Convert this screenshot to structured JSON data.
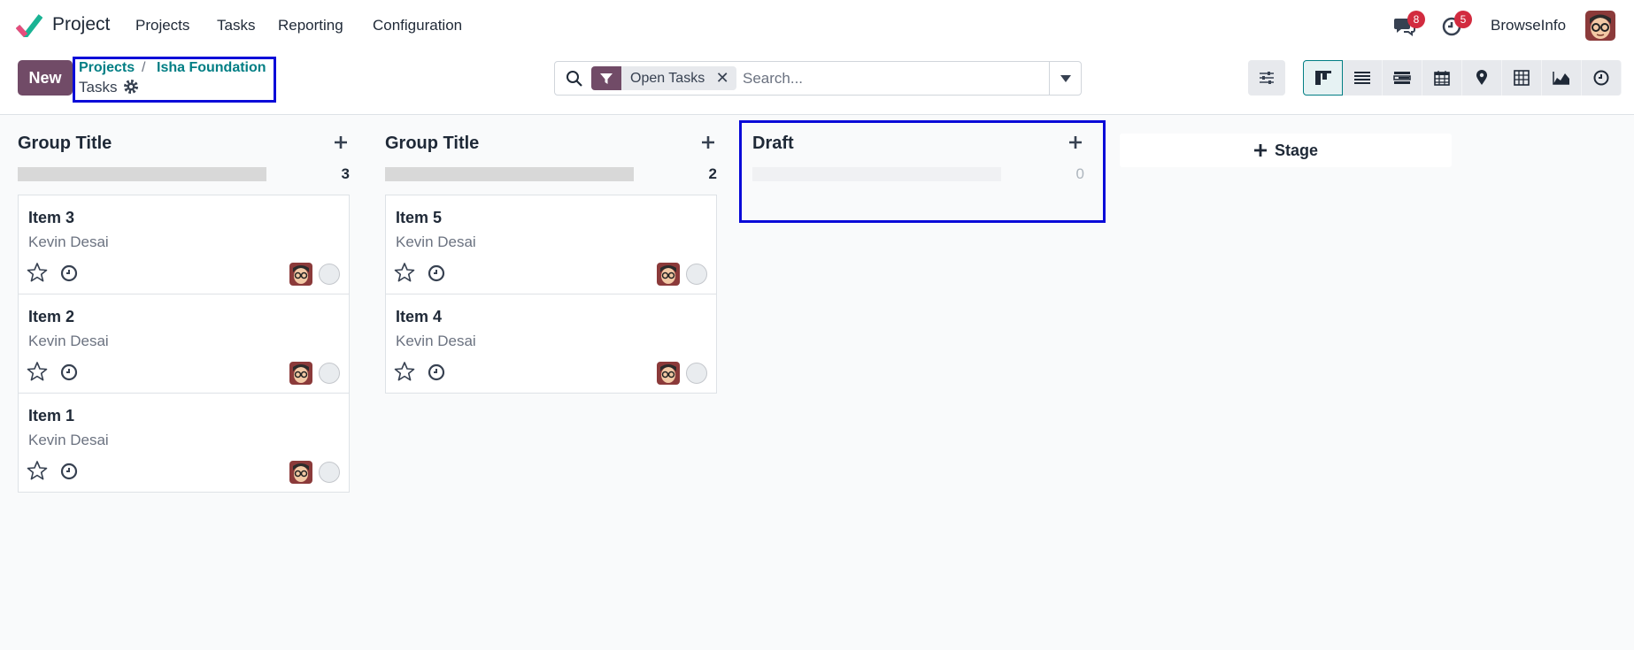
{
  "navbar": {
    "app_name": "Project",
    "menu": [
      "Projects",
      "Tasks",
      "Reporting",
      "Configuration"
    ],
    "messages_count": "8",
    "activities_count": "5",
    "user_name": "BrowseInfo"
  },
  "control": {
    "new_label": "New",
    "breadcrumb": [
      "Projects",
      "Isha Foundation"
    ],
    "breadcrumb_sep": "/",
    "current": "Tasks",
    "search": {
      "facet": "Open Tasks",
      "placeholder": "Search..."
    },
    "views": [
      "kanban",
      "list",
      "gantt",
      "calendar",
      "map",
      "pivot",
      "graph",
      "activity"
    ]
  },
  "kanban": {
    "columns": [
      {
        "title": "Group Title",
        "count": "3",
        "cards": [
          {
            "title": "Item 3",
            "assignee": "Kevin Desai"
          },
          {
            "title": "Item 2",
            "assignee": "Kevin Desai"
          },
          {
            "title": "Item 1",
            "assignee": "Kevin Desai"
          }
        ]
      },
      {
        "title": "Group Title",
        "count": "2",
        "cards": [
          {
            "title": "Item 5",
            "assignee": "Kevin Desai"
          },
          {
            "title": "Item 4",
            "assignee": "Kevin Desai"
          }
        ]
      },
      {
        "title": "Draft",
        "count": "0",
        "cards": []
      }
    ],
    "add_stage_label": "Stage"
  },
  "colors": {
    "brand": "#714b67",
    "link": "#017e84",
    "highlight": "#0a0ad8",
    "badge": "#d22b3f"
  }
}
